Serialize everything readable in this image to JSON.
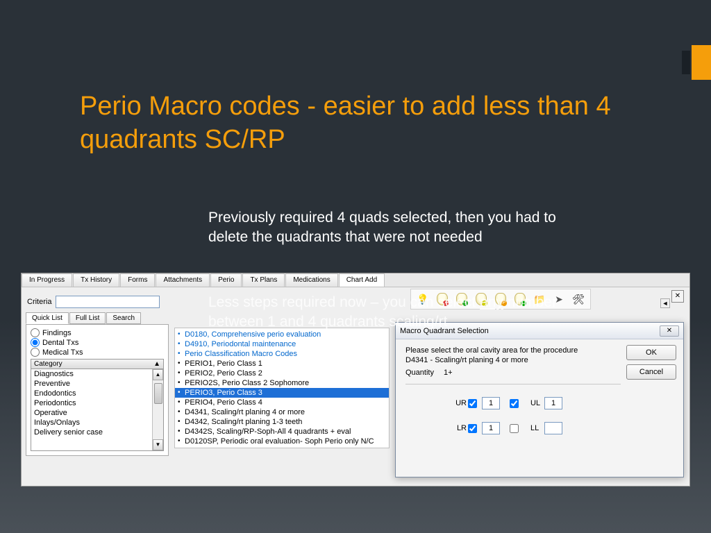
{
  "slide": {
    "title": "Perio Macro codes  - easier to add less than 4 quadrants SC/RP",
    "body1": "Previously required 4 quads selected, then you had to delete the quadrants that were not needed",
    "body2_pre": "Less steps required now – you can select ",
    "body2_u": "any",
    "body2_post": " number between 1 and 4 quadrants scaling/rt"
  },
  "tabs": [
    "In Progress",
    "Tx History",
    "Forms",
    "Attachments",
    "Perio",
    "Tx Plans",
    "Medications",
    "Chart Add"
  ],
  "criteria_label": "Criteria",
  "subtabs": [
    "Quick List",
    "Full List",
    "Search"
  ],
  "radios": {
    "findings": "Findings",
    "dental": "Dental Txs",
    "medical": "Medical Txs"
  },
  "category_header": "Category",
  "categories": [
    "Diagnostics",
    "Preventive",
    "Endodontics",
    "Periodontics",
    "Operative",
    "Inlays/Onlays",
    "Delivery senior case"
  ],
  "codes": [
    {
      "t": "D0180, Comprehensive perio evaluation",
      "cls": "blue"
    },
    {
      "t": "D4910, Periodontal maintenance",
      "cls": "blue"
    },
    {
      "t": "Perio Classification Macro Codes",
      "cls": "blue"
    },
    {
      "t": "PERIO1, Perio Class 1",
      "cls": ""
    },
    {
      "t": "PERIO2, Perio Class 2",
      "cls": ""
    },
    {
      "t": "PERIO2S, Perio Class 2 Sophomore",
      "cls": ""
    },
    {
      "t": "PERIO3, Perio Class 3",
      "cls": "sel"
    },
    {
      "t": "PERIO4, Perio Class 4",
      "cls": ""
    },
    {
      "t": "D4341, Scaling/rt planing 4 or more",
      "cls": ""
    },
    {
      "t": "D4342, Scaling/rt planing 1-3 teeth",
      "cls": ""
    },
    {
      "t": "D4342S, Scaling/RP-Soph-All 4 quadrants + eval",
      "cls": ""
    },
    {
      "t": "D0120SP, Periodic oral evaluation- Soph Perio only N/C",
      "cls": ""
    }
  ],
  "dialog": {
    "title": "Macro Quadrant Selection",
    "line1": "Please select the oral cavity area for the procedure",
    "line2": "D4341 - Scaling/rt planing 4 or more",
    "qty_label": "Quantity",
    "qty_value": "1+",
    "ok": "OK",
    "cancel": "Cancel",
    "quads": {
      "ur": {
        "label": "UR",
        "checked": true,
        "val": "1"
      },
      "ul": {
        "label": "UL",
        "checked": true,
        "val": "1"
      },
      "lr": {
        "label": "LR",
        "checked": true,
        "val": "1"
      },
      "ll": {
        "label": "LL",
        "checked": false,
        "val": ""
      }
    }
  },
  "toolbar_icons": [
    "bulb",
    "tooth-red",
    "tooth-green",
    "tooth-yellow",
    "tooth-p",
    "tooth-c",
    "folder",
    "arrow",
    "tools"
  ]
}
